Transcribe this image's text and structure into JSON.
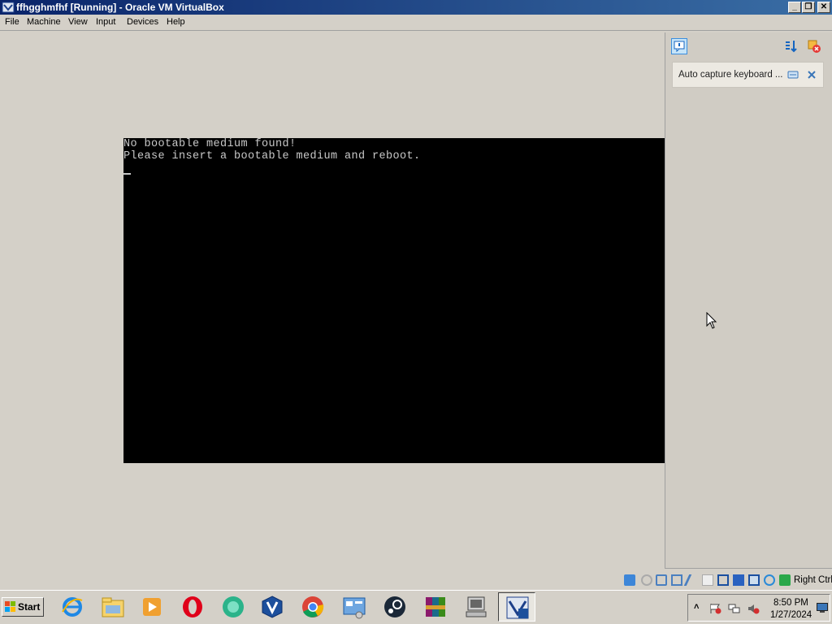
{
  "window": {
    "title": "ffhgghmfhf [Running] - Oracle VM VirtualBox",
    "controls": {
      "minimize": "_",
      "restore": "❐",
      "close": "✕"
    }
  },
  "menu": {
    "items": [
      "File",
      "Machine",
      "View",
      "Input",
      "Devices",
      "Help"
    ]
  },
  "guest_screen": {
    "lines": [
      "No bootable medium found!",
      "Please insert a bootable medium and reboot."
    ]
  },
  "notification_center": {
    "message": "Auto capture keyboard ...",
    "icons": [
      "notification-center-icon",
      "sort-icon",
      "close-all-icon",
      "toggle-icon",
      "dismiss-icon"
    ]
  },
  "status_bar": {
    "icons": [
      "hard-disk-icon",
      "optical-disk-icon",
      "audio-icon",
      "network-icon",
      "usb-icon",
      "shared-folders-icon",
      "display-icon",
      "recording-icon",
      "cpu-icon",
      "mouse-integration-icon",
      "keyboard-icon"
    ],
    "host_key": "Right Ctrl"
  },
  "taskbar": {
    "start_label": "Start",
    "apps": [
      "internet-explorer-icon",
      "file-explorer-icon",
      "media-player-icon",
      "opera-icon",
      "app-icon",
      "virtualbox-icon",
      "chrome-icon",
      "control-panel-icon",
      "steam-icon",
      "winrar-icon",
      "computer-icon",
      "virtualbox-vm-icon"
    ],
    "tray": {
      "chevron": "˄",
      "time": "8:50 PM",
      "date": "1/27/2024"
    }
  }
}
